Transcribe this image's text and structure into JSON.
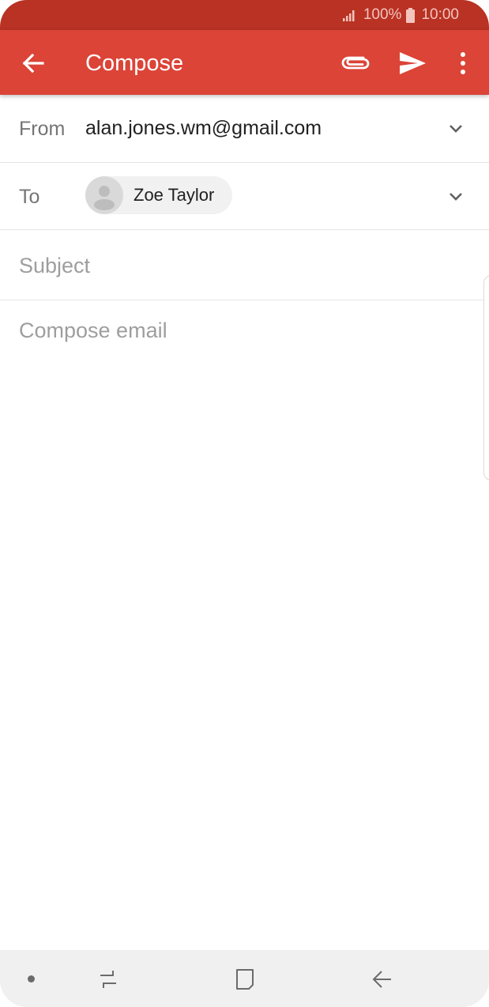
{
  "status_bar": {
    "battery_percent": "100%",
    "time": "10:00"
  },
  "app_bar": {
    "title": "Compose",
    "icons": [
      "back-arrow-icon",
      "paperclip-icon",
      "send-icon",
      "more-vert-icon"
    ]
  },
  "from_row": {
    "label": "From",
    "value": "alan.jones.wm@gmail.com"
  },
  "to_row": {
    "label": "To",
    "recipient": "Zoe Taylor"
  },
  "subject": {
    "placeholder": "Subject"
  },
  "body": {
    "placeholder": "Compose email"
  },
  "colors": {
    "accent": "#db4437",
    "status_bar": "#b93224",
    "nav_bar": "#f0f0f0"
  }
}
